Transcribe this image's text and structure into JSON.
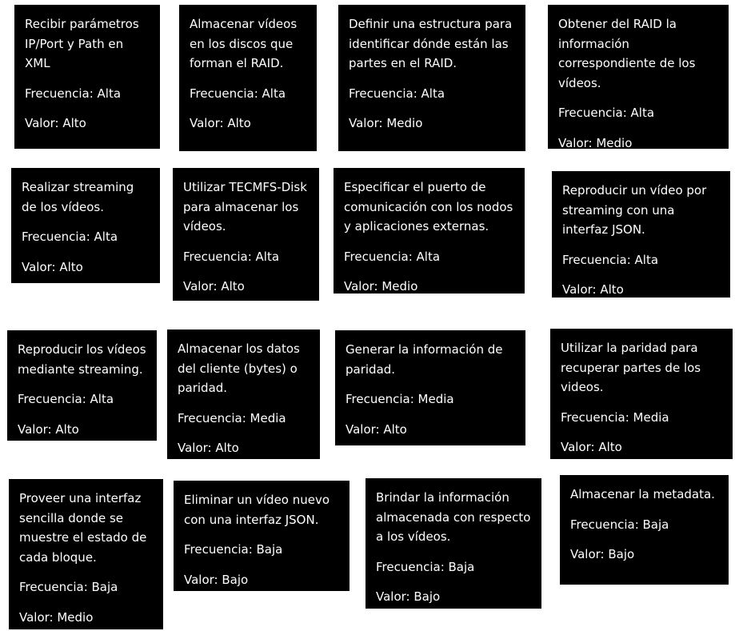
{
  "colors": {
    "card_background": "#000000",
    "card_text": "#ffffff",
    "page_background": "#ffffff"
  },
  "cards": [
    {
      "task": "Recibir parámetros\nIP/Port y Path en\nXML",
      "frecuencia": "Frecuencia: Alta",
      "valor": "Valor: Alto"
    },
    {
      "task": "Almacenar vídeos\nen los discos que\nforman el RAID.",
      "frecuencia": "Frecuencia: Alta",
      "valor": "Valor: Alto"
    },
    {
      "task": "Definir una estructura para\nidentificar dónde están las\npartes en el RAID.",
      "frecuencia": "Frecuencia: Alta",
      "valor": "Valor: Medio"
    },
    {
      "task": "Obtener del RAID la\ninformación\ncorrespondiente de los\nvídeos.",
      "frecuencia": "Frecuencia: Alta",
      "valor": "Valor: Medio"
    },
    {
      "task": "Realizar streaming\nde los vídeos.",
      "frecuencia": "Frecuencia: Alta",
      "valor": "Valor: Alto"
    },
    {
      "task": "Utilizar TECMFS-Disk\npara almacenar los\nvídeos.",
      "frecuencia": "Frecuencia: Alta",
      "valor": " Valor: Alto"
    },
    {
      "task": "Especificar el puerto de\ncomunicación con los nodos\ny aplicaciones externas.",
      "frecuencia": "Frecuencia: Alta",
      "valor": "Valor: Medio"
    },
    {
      "task": "Reproducir un vídeo por\nstreaming con una\ninterfaz JSON.",
      "frecuencia": "Frecuencia: Alta",
      "valor": "Valor: Alto"
    },
    {
      "task": "Reproducir los vídeos\nmediante streaming.",
      "frecuencia": "Frecuencia: Alta",
      "valor": "Valor: Alto"
    },
    {
      "task": "Almacenar los datos\ndel cliente (bytes) o\nparidad.",
      "frecuencia": "Frecuencia: Media",
      "valor": "Valor: Alto"
    },
    {
      "task": "Generar la información de\nparidad.",
      "frecuencia": "Frecuencia: Media",
      "valor": "Valor: Alto"
    },
    {
      "task": "Utilizar la paridad para\nrecuperar partes de los\nvideos.",
      "frecuencia": "Frecuencia: Media",
      "valor": "Valor: Alto"
    },
    {
      "task": "Proveer una interfaz\nsencilla donde se\nmuestre el estado de\ncada bloque.",
      "frecuencia": "Frecuencia: Baja",
      "valor": "Valor: Medio"
    },
    {
      "task": "Eliminar un vídeo nuevo\ncon una interfaz JSON.",
      "frecuencia": "Frecuencia: Baja",
      "valor": "Valor: Bajo"
    },
    {
      "task": "Brindar la información\nalmacenada con respecto\na los vídeos.",
      "frecuencia": "Frecuencia: Baja",
      "valor": "Valor: Bajo"
    },
    {
      "task": "Almacenar la metadata.",
      "frecuencia": "Frecuencia: Baja",
      "valor": "Valor: Bajo"
    }
  ]
}
